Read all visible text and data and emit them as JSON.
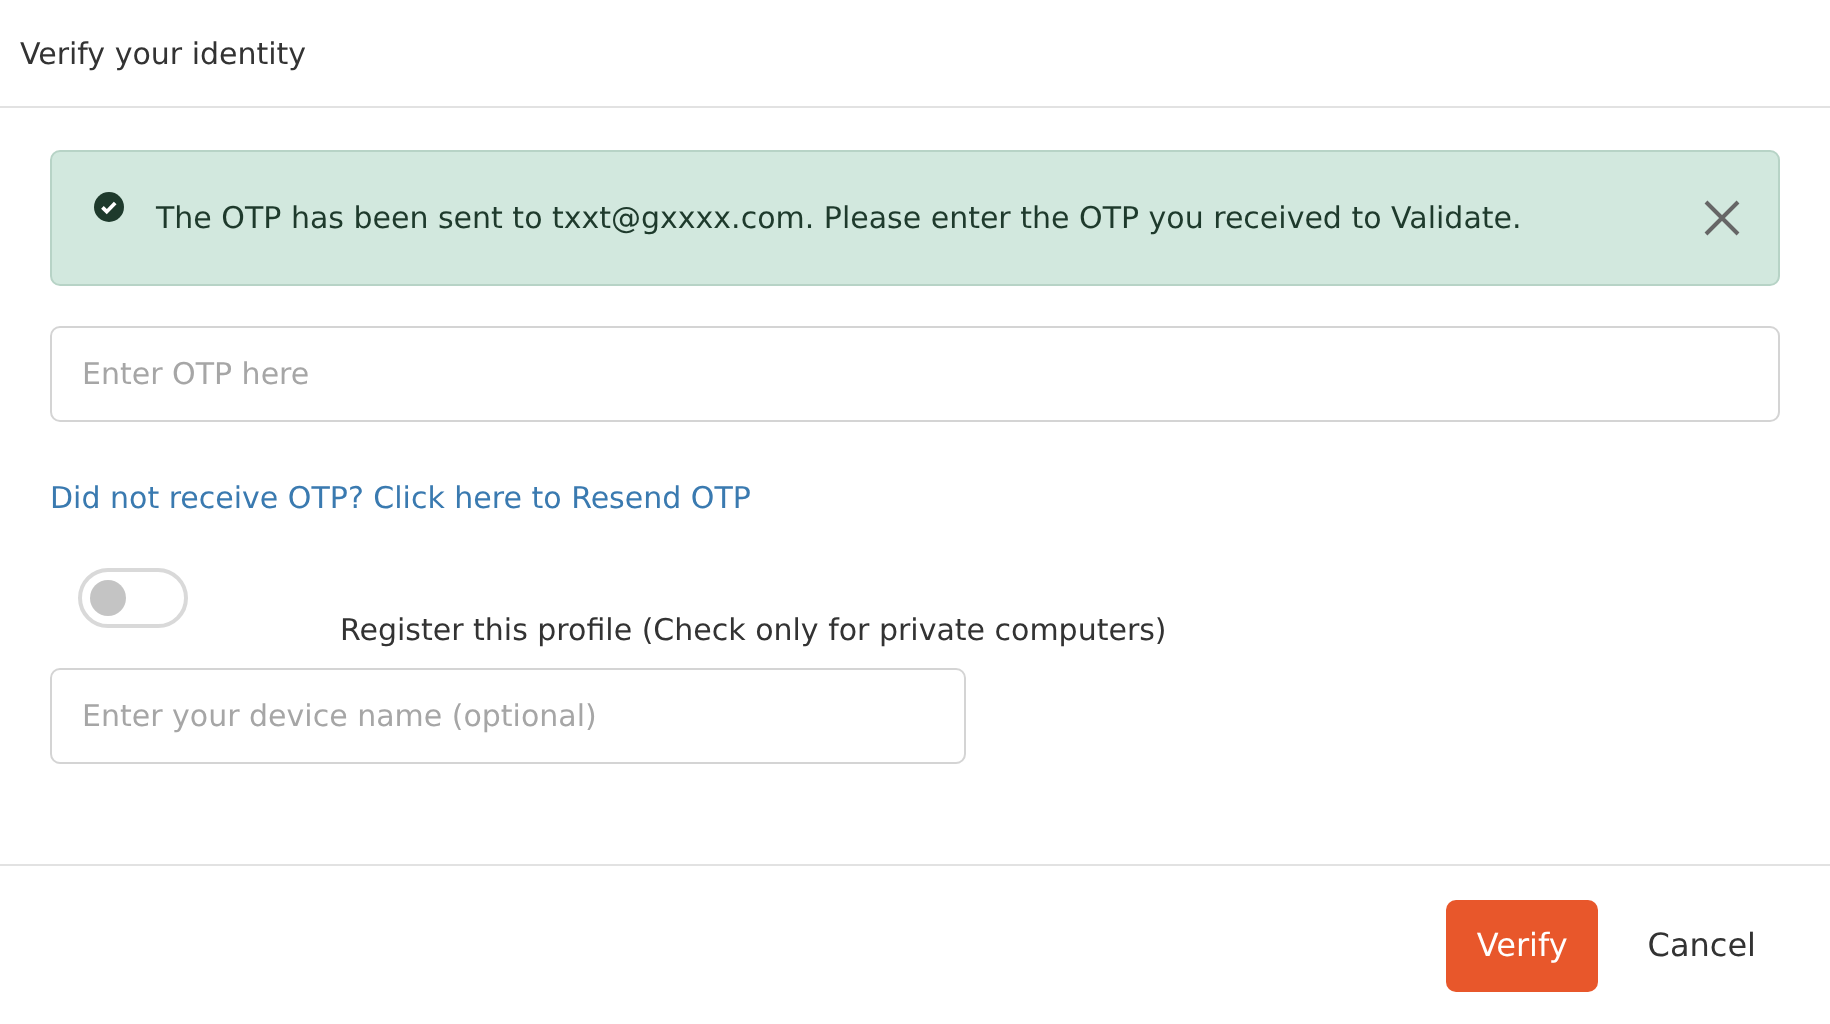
{
  "dialog": {
    "title": "Verify your identity"
  },
  "alert": {
    "message": "The OTP has been sent to txxt@gxxxx.com. Please enter the OTP you received to Validate."
  },
  "otp_field": {
    "placeholder": "Enter OTP here"
  },
  "resend_link": "Did not receive OTP? Click here to Resend OTP",
  "register_toggle": {
    "on": false,
    "label": "Register this profile (Check only for private computers)"
  },
  "device_field": {
    "placeholder": "Enter your device name (optional)"
  },
  "buttons": [
    {
      "label": "Verify",
      "kind": "primary"
    },
    {
      "label": "Cancel",
      "kind": "plain"
    }
  ]
}
